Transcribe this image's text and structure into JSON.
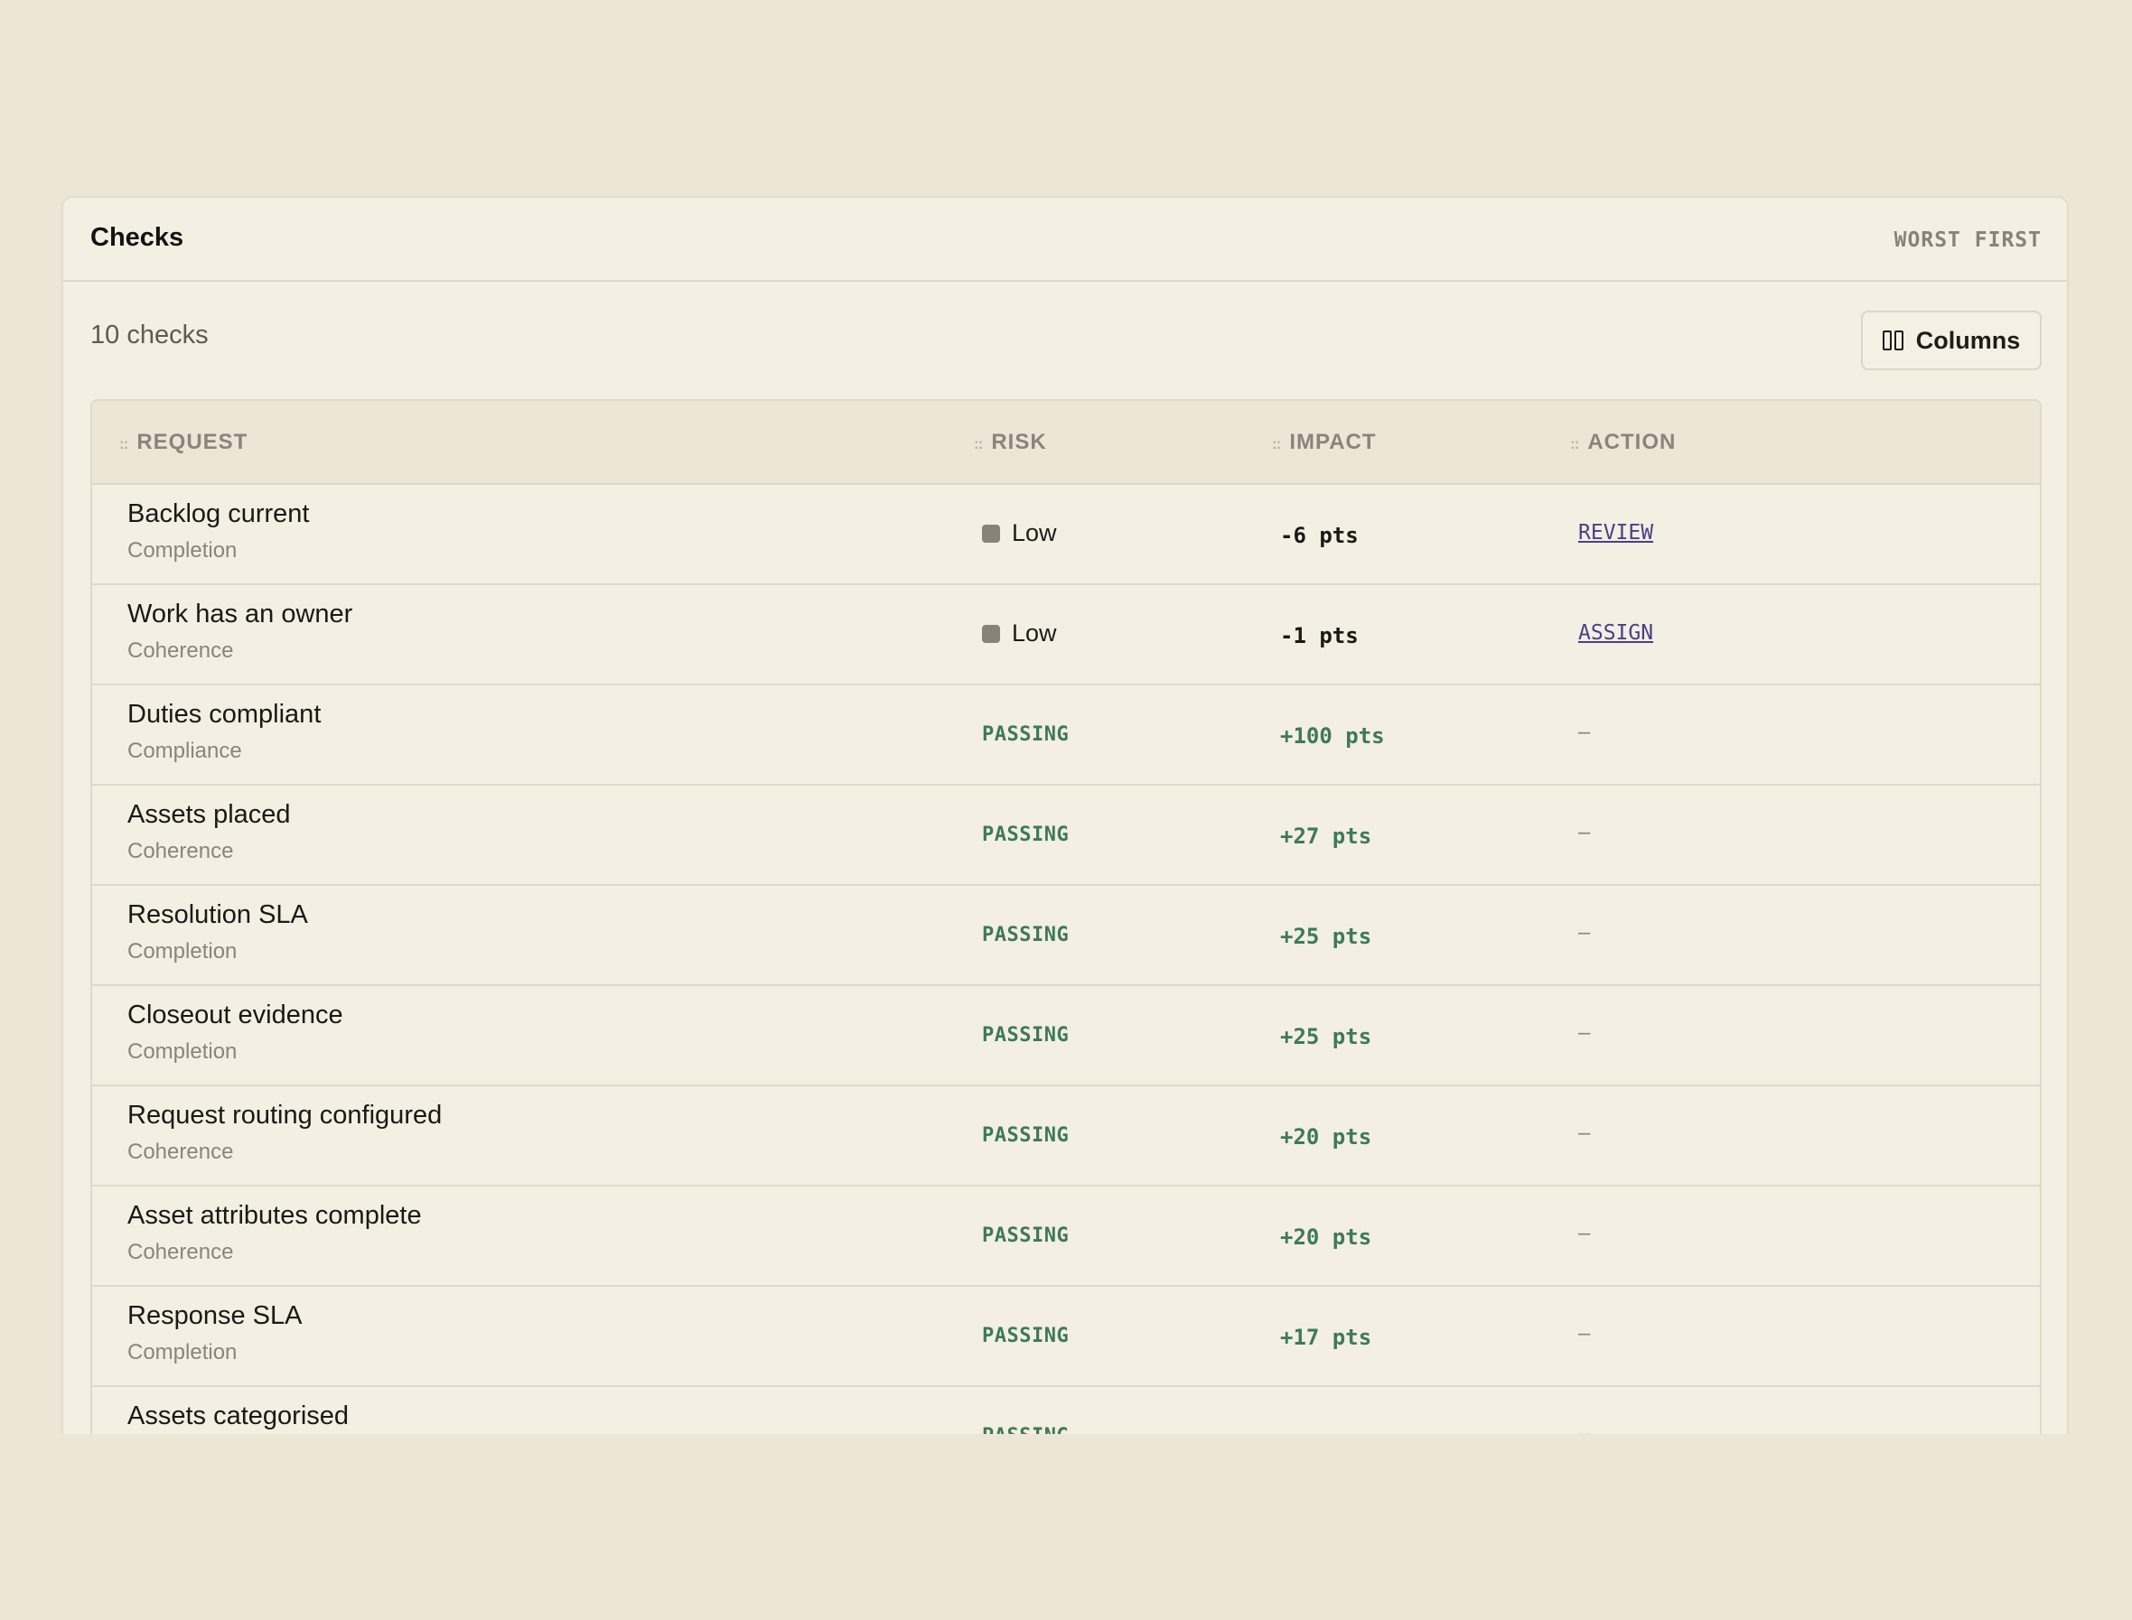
{
  "panel": {
    "title": "Checks",
    "sort_label": "WORST FIRST",
    "count_label": "10 checks",
    "columns_button": "Columns"
  },
  "table": {
    "headers": {
      "request": "REQUEST",
      "risk": "RISK",
      "impact": "IMPACT",
      "action": "ACTION"
    },
    "grip_icon": "drag-grip-icon",
    "rows": [
      {
        "title": "Backlog current",
        "category": "Completion",
        "risk": "Low",
        "status": "risk",
        "impact": "-6 pts",
        "action": "REVIEW"
      },
      {
        "title": "Work has an owner",
        "category": "Coherence",
        "risk": "Low",
        "status": "risk",
        "impact": "-1 pts",
        "action": "ASSIGN"
      },
      {
        "title": "Duties compliant",
        "category": "Compliance",
        "risk": "PASSING",
        "status": "passing",
        "impact": "+100 pts",
        "action": "–"
      },
      {
        "title": "Assets placed",
        "category": "Coherence",
        "risk": "PASSING",
        "status": "passing",
        "impact": "+27 pts",
        "action": "–"
      },
      {
        "title": "Resolution SLA",
        "category": "Completion",
        "risk": "PASSING",
        "status": "passing",
        "impact": "+25 pts",
        "action": "–"
      },
      {
        "title": "Closeout evidence",
        "category": "Completion",
        "risk": "PASSING",
        "status": "passing",
        "impact": "+25 pts",
        "action": "–"
      },
      {
        "title": "Request routing configured",
        "category": "Coherence",
        "risk": "PASSING",
        "status": "passing",
        "impact": "+20 pts",
        "action": "–"
      },
      {
        "title": "Asset attributes complete",
        "category": "Coherence",
        "risk": "PASSING",
        "status": "passing",
        "impact": "+20 pts",
        "action": "–"
      },
      {
        "title": "Response SLA",
        "category": "Completion",
        "risk": "PASSING",
        "status": "passing",
        "impact": "+17 pts",
        "action": "–"
      },
      {
        "title": "Assets categorised",
        "category": "",
        "risk": "PASSING",
        "status": "passing",
        "impact": "",
        "action": "–"
      }
    ]
  },
  "colors": {
    "background": "#ede6d7",
    "panel": "#f3efe2",
    "passing_green": "#3e7a55",
    "link_purple": "#4a3f8a",
    "risk_dot_gray": "#87837a"
  }
}
